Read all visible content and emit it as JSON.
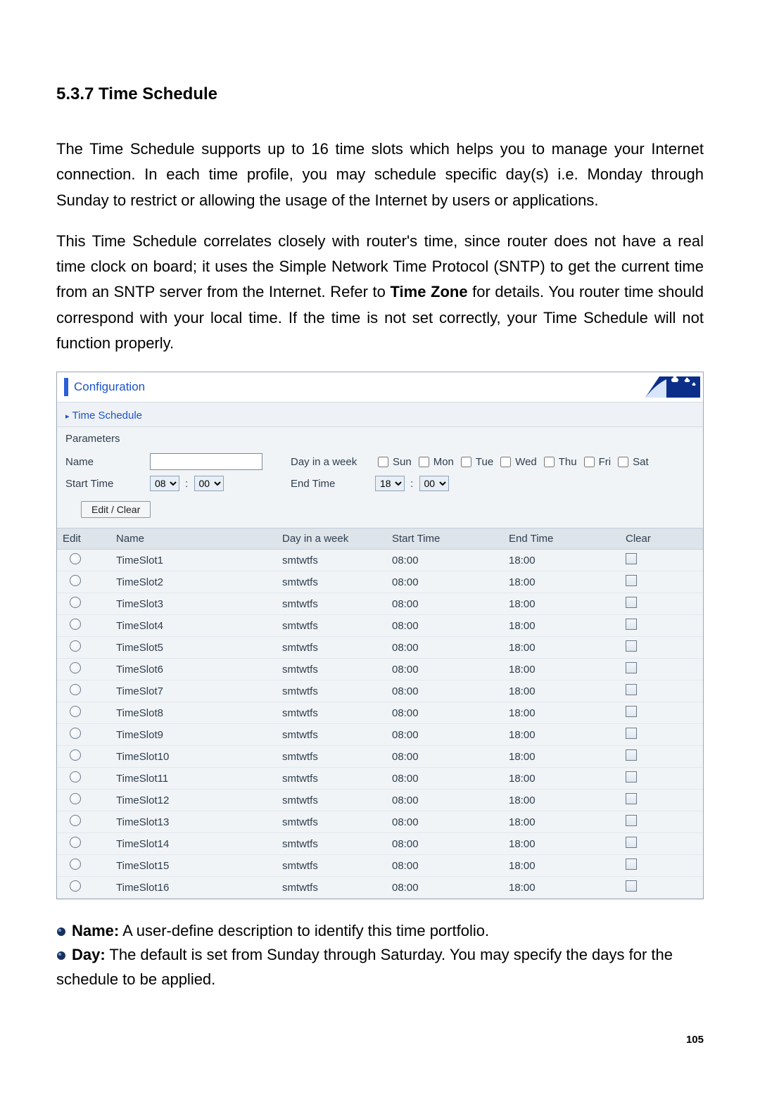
{
  "heading": "5.3.7 Time Schedule",
  "para1": "The Time Schedule supports up to 16 time slots which helps you to manage your Internet connection.   In each time profile, you may schedule specific day(s) i.e. Monday through Sunday to restrict or allowing the usage of the Internet by users or applications.",
  "para2_a": "This Time Schedule correlates closely with router's time, since router does not have a real time clock on board; it uses the Simple Network Time Protocol (SNTP) to get the current time from an SNTP server from the Internet. Refer to ",
  "para2_bold": "Time Zone",
  "para2_b": " for details.   You router time should correspond with your local time.  If the time is not set correctly, your Time Schedule will not function properly.",
  "panel": {
    "configuration_label": "Configuration",
    "time_schedule_label": "Time Schedule",
    "parameters_label": "Parameters",
    "name_label": "Name",
    "day_in_week_label": "Day in a week",
    "start_time_label": "Start Time",
    "end_time_label": "End Time",
    "days": [
      "Sun",
      "Mon",
      "Tue",
      "Wed",
      "Thu",
      "Fri",
      "Sat"
    ],
    "start_hour": "08",
    "start_min": "00",
    "end_hour": "18",
    "end_min": "00",
    "edit_clear_button": "Edit / Clear",
    "table_headers": {
      "edit": "Edit",
      "name": "Name",
      "day": "Day in a week",
      "start": "Start Time",
      "end": "End Time",
      "clear": "Clear"
    },
    "rows": [
      {
        "name": "TimeSlot1",
        "day": "smtwtfs",
        "start": "08:00",
        "end": "18:00"
      },
      {
        "name": "TimeSlot2",
        "day": "smtwtfs",
        "start": "08:00",
        "end": "18:00"
      },
      {
        "name": "TimeSlot3",
        "day": "smtwtfs",
        "start": "08:00",
        "end": "18:00"
      },
      {
        "name": "TimeSlot4",
        "day": "smtwtfs",
        "start": "08:00",
        "end": "18:00"
      },
      {
        "name": "TimeSlot5",
        "day": "smtwtfs",
        "start": "08:00",
        "end": "18:00"
      },
      {
        "name": "TimeSlot6",
        "day": "smtwtfs",
        "start": "08:00",
        "end": "18:00"
      },
      {
        "name": "TimeSlot7",
        "day": "smtwtfs",
        "start": "08:00",
        "end": "18:00"
      },
      {
        "name": "TimeSlot8",
        "day": "smtwtfs",
        "start": "08:00",
        "end": "18:00"
      },
      {
        "name": "TimeSlot9",
        "day": "smtwtfs",
        "start": "08:00",
        "end": "18:00"
      },
      {
        "name": "TimeSlot10",
        "day": "smtwtfs",
        "start": "08:00",
        "end": "18:00"
      },
      {
        "name": "TimeSlot11",
        "day": "smtwtfs",
        "start": "08:00",
        "end": "18:00"
      },
      {
        "name": "TimeSlot12",
        "day": "smtwtfs",
        "start": "08:00",
        "end": "18:00"
      },
      {
        "name": "TimeSlot13",
        "day": "smtwtfs",
        "start": "08:00",
        "end": "18:00"
      },
      {
        "name": "TimeSlot14",
        "day": "smtwtfs",
        "start": "08:00",
        "end": "18:00"
      },
      {
        "name": "TimeSlot15",
        "day": "smtwtfs",
        "start": "08:00",
        "end": "18:00"
      },
      {
        "name": "TimeSlot16",
        "day": "smtwtfs",
        "start": "08:00",
        "end": "18:00"
      }
    ]
  },
  "bullets": {
    "name_label": "Name:",
    "name_text": " A user-define description to identify this time portfolio.",
    "day_label": "Day:",
    "day_text": " The default is set from Sunday through Saturday. You may specify the days for the schedule to be applied."
  },
  "page_number": "105"
}
